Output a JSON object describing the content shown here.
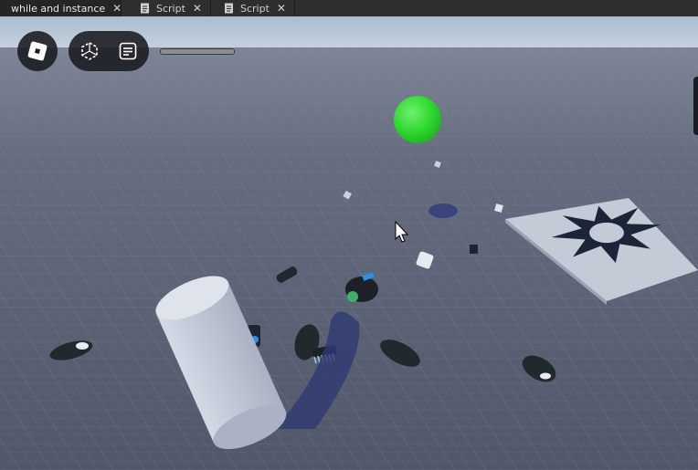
{
  "tabs": [
    {
      "label": "while and instance",
      "active": true,
      "icon": null
    },
    {
      "label": "Script",
      "active": false,
      "icon": "script-doc-icon"
    },
    {
      "label": "Script",
      "active": false,
      "icon": "script-doc-icon"
    }
  ],
  "close_glyph": "✕",
  "toolbar": {
    "roblox_button": "roblox-logo-icon",
    "selection_button": "cube-select-icon",
    "chat_button": "chat-icon"
  },
  "colors": {
    "sky": "#b3c6d6",
    "baseplate": "#5b6275",
    "sphere": "#2fd82f",
    "cylinder": "#c9d0dd",
    "decal_plate": "#c9cfdc",
    "decal_star": "#1b2538"
  }
}
